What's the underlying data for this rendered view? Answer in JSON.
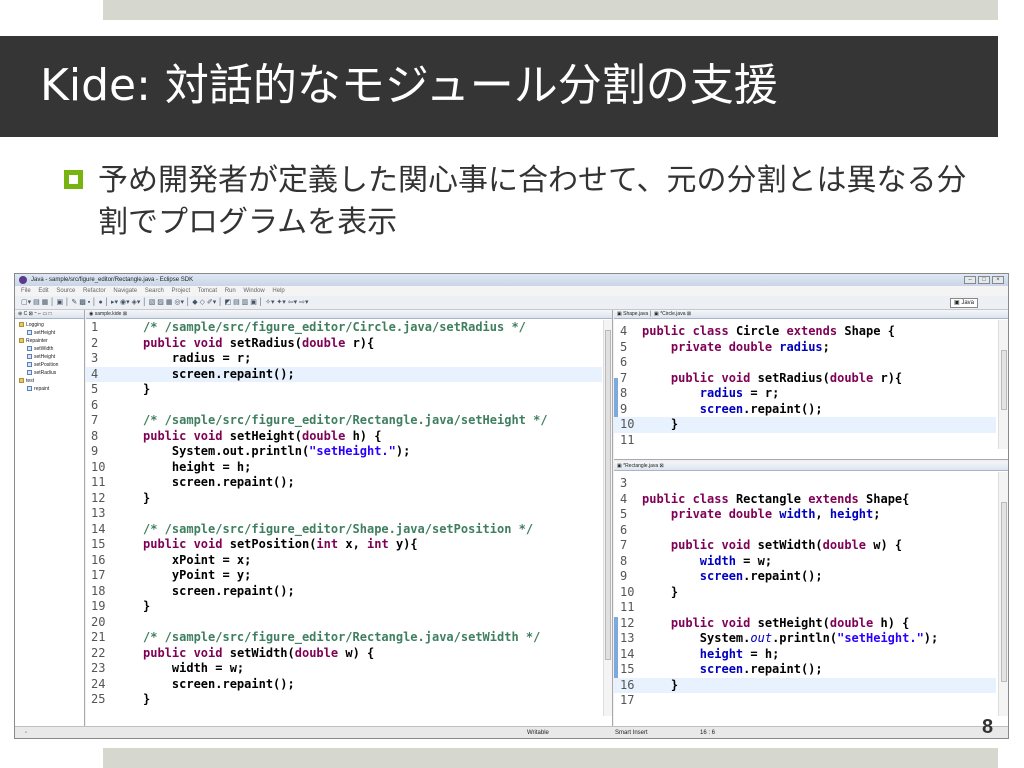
{
  "slide": {
    "title": "Kide: 対話的なモジュール分割の支援",
    "bullet": "予め開発者が定義した関心事に合わせて、元の分割とは異なる分割でプログラムを表示",
    "page_number": "8"
  },
  "eclipse": {
    "window_title": "Java - sample/src/figure_editor/Rectangle.java - Eclipse SDK",
    "menu": [
      "File",
      "Edit",
      "Source",
      "Refactor",
      "Navigate",
      "Search",
      "Project",
      "Tomcat",
      "Run",
      "Window",
      "Help"
    ],
    "perspective": "Java",
    "outline": {
      "tab_label": "C",
      "items": [
        {
          "label": "Logging",
          "kind": "folder",
          "level": 0
        },
        {
          "label": "setHeight",
          "kind": "node",
          "level": 1
        },
        {
          "label": "Repainter",
          "kind": "folder",
          "level": 0
        },
        {
          "label": "setWidth",
          "kind": "node",
          "level": 1
        },
        {
          "label": "setHeight",
          "kind": "node",
          "level": 1
        },
        {
          "label": "setPosition",
          "kind": "node",
          "level": 1
        },
        {
          "label": "setRadius",
          "kind": "node",
          "level": 1
        },
        {
          "label": "test",
          "kind": "folder",
          "level": 0
        },
        {
          "label": "repaint",
          "kind": "node",
          "level": 1
        }
      ]
    },
    "main_editor": {
      "tab_label": "sample.kide"
    },
    "right_top": {
      "tabs": [
        "Shape.java",
        "*Circle.java"
      ]
    },
    "right_bottom": {
      "tabs": [
        "*Rectangle.java"
      ]
    },
    "status": {
      "writable": "Writable",
      "insert_mode": "Smart Insert",
      "position": "16 : 6"
    }
  }
}
